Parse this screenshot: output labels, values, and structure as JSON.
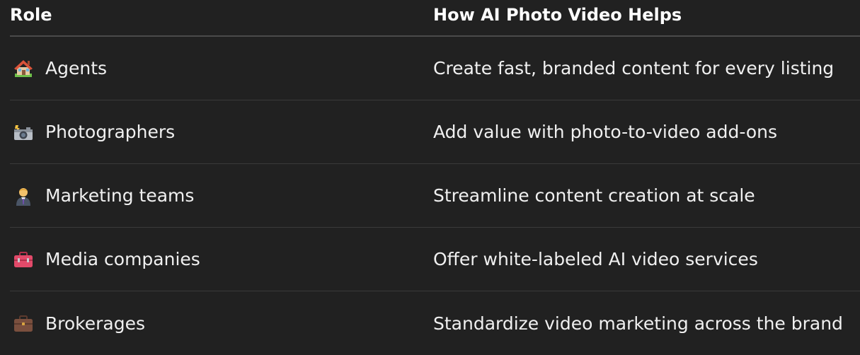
{
  "table": {
    "headers": {
      "role": "Role",
      "help": "How AI Photo Video Helps"
    },
    "rows": [
      {
        "icon": "house-icon",
        "role": "Agents",
        "help": "Create fast, branded content for every listing"
      },
      {
        "icon": "camera-flash-icon",
        "role": "Photographers",
        "help": "Add value with photo-to-video add-ons"
      },
      {
        "icon": "office-worker-icon",
        "role": "Marketing teams",
        "help": "Streamline content creation at scale"
      },
      {
        "icon": "toolbox-icon",
        "role": "Media companies",
        "help": "Offer white-labeled AI video services"
      },
      {
        "icon": "briefcase-icon",
        "role": "Brokerages",
        "help": "Standardize video marketing across the brand"
      }
    ]
  }
}
